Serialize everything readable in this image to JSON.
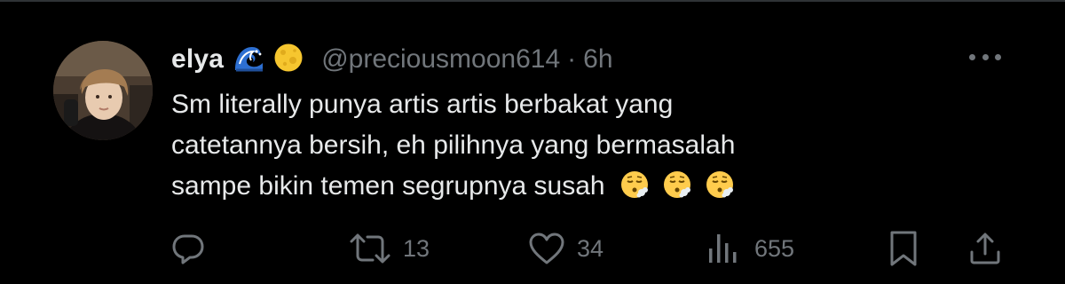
{
  "tweet": {
    "display_name": "elya",
    "name_emojis": [
      "wave-emoji",
      "full-moon-emoji"
    ],
    "handle": "@preciousmoon614",
    "separator": "·",
    "time": "6h",
    "text_lines": [
      "Sm literally punya artis artis berbakat yang",
      "catetannya bersih, eh pilihnya yang bermasalah",
      "sampe bikin temen segrupnya susah"
    ],
    "trailing_emojis": [
      "face-exhaling-emoji",
      "face-exhaling-emoji",
      "face-exhaling-emoji"
    ]
  },
  "actions": {
    "reply": {
      "icon": "reply-icon",
      "count": ""
    },
    "retweet": {
      "icon": "retweet-icon",
      "count": "13"
    },
    "like": {
      "icon": "heart-icon",
      "count": "34"
    },
    "views": {
      "icon": "views-icon",
      "count": "655"
    },
    "bookmark": {
      "icon": "bookmark-icon",
      "count": ""
    },
    "share": {
      "icon": "share-icon",
      "count": ""
    }
  },
  "colors": {
    "background": "#000000",
    "primary_text": "#e7e9ea",
    "secondary_text": "#71767b",
    "divider": "#2f3336"
  }
}
